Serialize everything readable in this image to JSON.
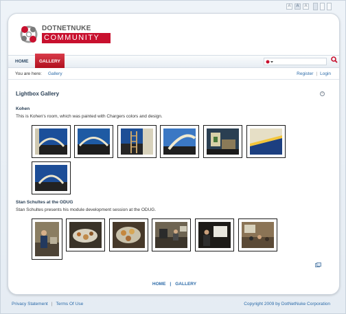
{
  "logo": {
    "top_text": "DOTNETNUKE",
    "bottom_text": "COMMUNITY",
    "brand_color": "#c8102e"
  },
  "text_size_controls": [
    "A",
    "A",
    "A"
  ],
  "nav": {
    "items": [
      {
        "label": "HOME"
      },
      {
        "label": "GALLERY"
      }
    ],
    "active": "GALLERY",
    "active_color": "#c8102e"
  },
  "search": {
    "value": "",
    "engine_icon": "search-engine-icon",
    "go_icon": "magnifier-icon"
  },
  "breadcrumb": {
    "label": "You are here:",
    "link": "Gallery"
  },
  "auth": {
    "register": "Register",
    "login": "Login"
  },
  "module": {
    "title": "Lightbox Gallery",
    "collapse_icon": "collapse-icon"
  },
  "albums": [
    {
      "title": "Kohen",
      "description": "This is Kohen's room, which was painted with Chargers colors and design.",
      "photos": [
        "arch-wall-1",
        "arch-wall-2",
        "ladder-room",
        "arch-wall-3",
        "paint-cans",
        "wall-stripe",
        "arch-wall-4"
      ]
    },
    {
      "title": "Stan Schultes at the ODUG",
      "description": "Stan Schultes presents his module development session at the ODUG.",
      "photos": [
        "presenter-standing",
        "food-table",
        "food-platter",
        "meeting-room-1",
        "presenter-screen",
        "audience-room"
      ]
    }
  ],
  "footer": {
    "links": [
      "HOME",
      "GALLERY"
    ]
  },
  "bottom": {
    "privacy": "Privacy Statement",
    "terms": "Terms Of Use",
    "copyright": "Copyright 2009 by DotNetNuke Corporation"
  }
}
